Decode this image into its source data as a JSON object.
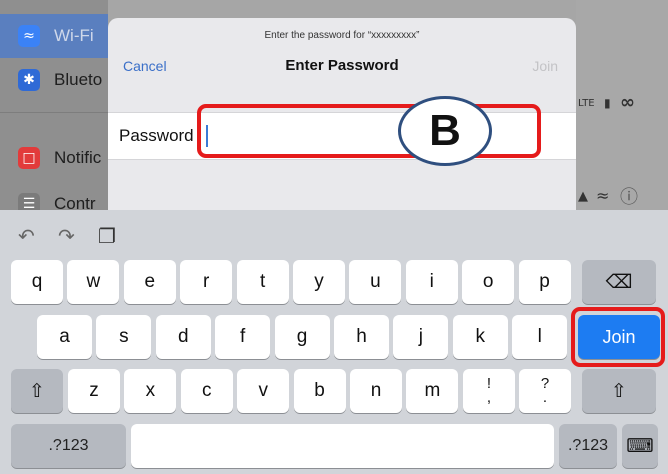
{
  "settings": {
    "items": [
      {
        "label": "Wi-Fi",
        "icon": "wifi-icon",
        "color": "#3b82f6"
      },
      {
        "label": "Blueto",
        "icon": "bluetooth-icon",
        "color": "#2f6ad6"
      },
      {
        "label": "Notific",
        "icon": "notifications-icon",
        "color": "#e23b3b"
      },
      {
        "label": "Contr",
        "icon": "control-center-icon",
        "color": "#7b7b7b"
      }
    ]
  },
  "status": {
    "lte": "LTE"
  },
  "dialog": {
    "prompt": "Enter the password for “xxxxxxxxx”",
    "cancel": "Cancel",
    "title": "Enter Password",
    "join": "Join",
    "password_label": "Password",
    "password_value": ""
  },
  "annotation": {
    "badge": "B",
    "highlight_color": "#e51b1b"
  },
  "keyboard": {
    "row1": [
      "q",
      "w",
      "e",
      "r",
      "t",
      "y",
      "u",
      "i",
      "o",
      "p"
    ],
    "row2": [
      "a",
      "s",
      "d",
      "f",
      "g",
      "h",
      "j",
      "k",
      "l"
    ],
    "row3": [
      "z",
      "x",
      "c",
      "v",
      "b",
      "n",
      "m"
    ],
    "punct1": {
      "top": "!",
      "bottom": ","
    },
    "punct2": {
      "top": "?",
      "bottom": "."
    },
    "join": "Join",
    "numbers": ".?123",
    "accent_color": "#1d7cf2"
  }
}
